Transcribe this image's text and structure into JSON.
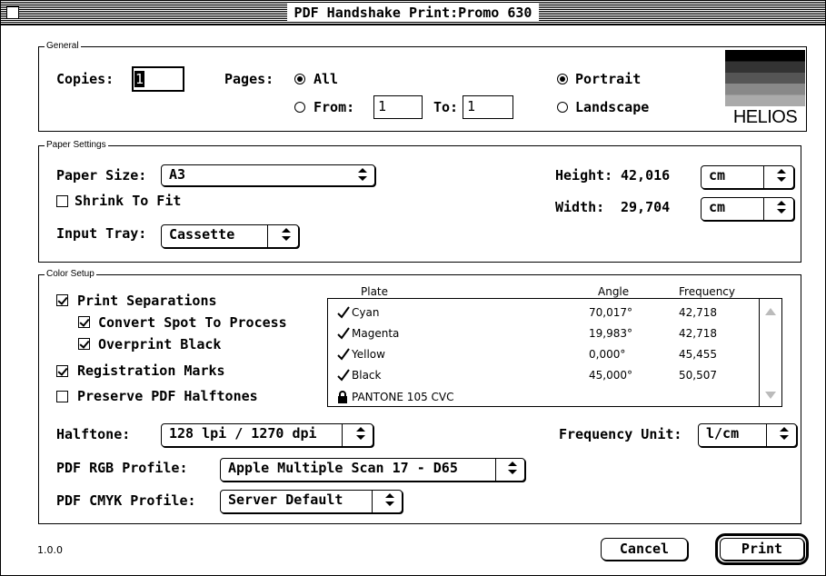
{
  "window": {
    "title": "PDF Handshake Print:Promo 630"
  },
  "general": {
    "group_label": "General",
    "copies_label": "Copies:",
    "copies_value": "1",
    "pages_label": "Pages:",
    "all_label": "All",
    "from_label": "From:",
    "from_value": "1",
    "to_label": "To:",
    "to_value": "1",
    "pages_selected": "All",
    "portrait_label": "Portrait",
    "landscape_label": "Landscape",
    "orientation_selected": "Portrait"
  },
  "logo": {
    "text": "HELIOS"
  },
  "paper": {
    "group_label": "Paper Settings",
    "size_label": "Paper Size:",
    "size_value": "A3",
    "shrink_label": "Shrink To Fit",
    "shrink_checked": false,
    "tray_label": "Input Tray:",
    "tray_value": "Cassette",
    "height_label": "Height:",
    "height_value": "42,016",
    "height_unit": "cm",
    "width_label": "Width:",
    "width_value": "29,704",
    "width_unit": "cm"
  },
  "color": {
    "group_label": "Color Setup",
    "print_separations": {
      "label": "Print Separations",
      "checked": true
    },
    "convert_spot": {
      "label": "Convert Spot To Process",
      "checked": true
    },
    "overprint_black": {
      "label": "Overprint Black",
      "checked": true
    },
    "registration_marks": {
      "label": "Registration Marks",
      "checked": true
    },
    "preserve_halftones": {
      "label": "Preserve PDF Halftones",
      "checked": false
    },
    "plates": {
      "headers": {
        "plate": "Plate",
        "angle": "Angle",
        "frequency": "Frequency"
      },
      "rows": [
        {
          "icon": "checkmark-icon",
          "plate": "Cyan",
          "angle": "70,017°",
          "frequency": "42,718"
        },
        {
          "icon": "checkmark-icon",
          "plate": "Magenta",
          "angle": "19,983°",
          "frequency": "42,718"
        },
        {
          "icon": "checkmark-icon",
          "plate": "Yellow",
          "angle": "0,000°",
          "frequency": "45,455"
        },
        {
          "icon": "checkmark-icon",
          "plate": "Black",
          "angle": "45,000°",
          "frequency": "50,507"
        },
        {
          "icon": "lock-icon",
          "plate": "PANTONE 105 CVC",
          "angle": "",
          "frequency": ""
        }
      ]
    },
    "halftone_label": "Halftone:",
    "halftone_value": "128 lpi / 1270 dpi",
    "frequency_unit_label": "Frequency Unit:",
    "frequency_unit_value": "l/cm",
    "rgb_profile_label": "PDF RGB Profile:",
    "rgb_profile_value": "Apple Multiple Scan 17 - D65",
    "cmyk_profile_label": "PDF CMYK Profile:",
    "cmyk_profile_value": "Server Default"
  },
  "footer": {
    "version": "1.0.0",
    "cancel_label": "Cancel",
    "print_label": "Print"
  }
}
